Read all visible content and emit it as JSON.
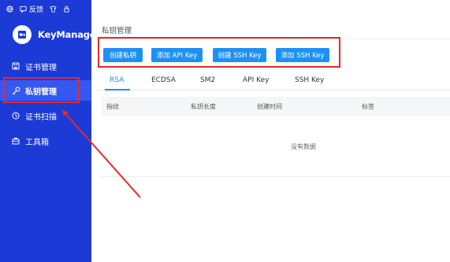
{
  "topbar": {
    "feedback": "反馈"
  },
  "brand": {
    "name": "KeyManager"
  },
  "sidebar": {
    "items": [
      {
        "label": "证书管理",
        "icon": "save-icon",
        "active": false
      },
      {
        "label": "私钥管理",
        "icon": "key-icon",
        "active": true
      },
      {
        "label": "证书扫描",
        "icon": "history-icon",
        "active": false
      },
      {
        "label": "工具箱",
        "icon": "toolbox-icon",
        "active": false
      }
    ]
  },
  "main": {
    "title": "私钥管理",
    "buttons": {
      "create_private_key": "创建私钥",
      "add_api_key": "添加 API Key",
      "create_ssh_key": "创建 SSH Key",
      "add_ssh_key": "添加 SSH Key"
    },
    "tabs": [
      {
        "label": "RSA",
        "active": true
      },
      {
        "label": "ECDSA",
        "active": false
      },
      {
        "label": "SM2",
        "active": false
      },
      {
        "label": "API Key",
        "active": false
      },
      {
        "label": "SSH Key",
        "active": false
      }
    ],
    "table": {
      "columns": [
        "指纹",
        "私钥长度",
        "创建时间",
        "标签"
      ],
      "empty_text": "没有数据"
    }
  },
  "colors": {
    "sidebar_bg": "#1b3ad6",
    "active_item_bg": "#3657f0",
    "primary": "#1e90f4",
    "annotation_red": "#e5292b"
  }
}
